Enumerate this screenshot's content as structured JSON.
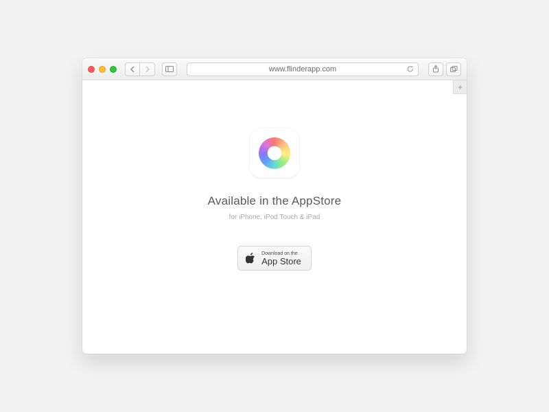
{
  "toolbar": {
    "url": "www.flinderapp.com"
  },
  "page": {
    "headline": "Available in the AppStore",
    "subline": "for iPhone, iPod Touch & iPad",
    "download_small": "Download on the",
    "download_big": "App Store"
  }
}
